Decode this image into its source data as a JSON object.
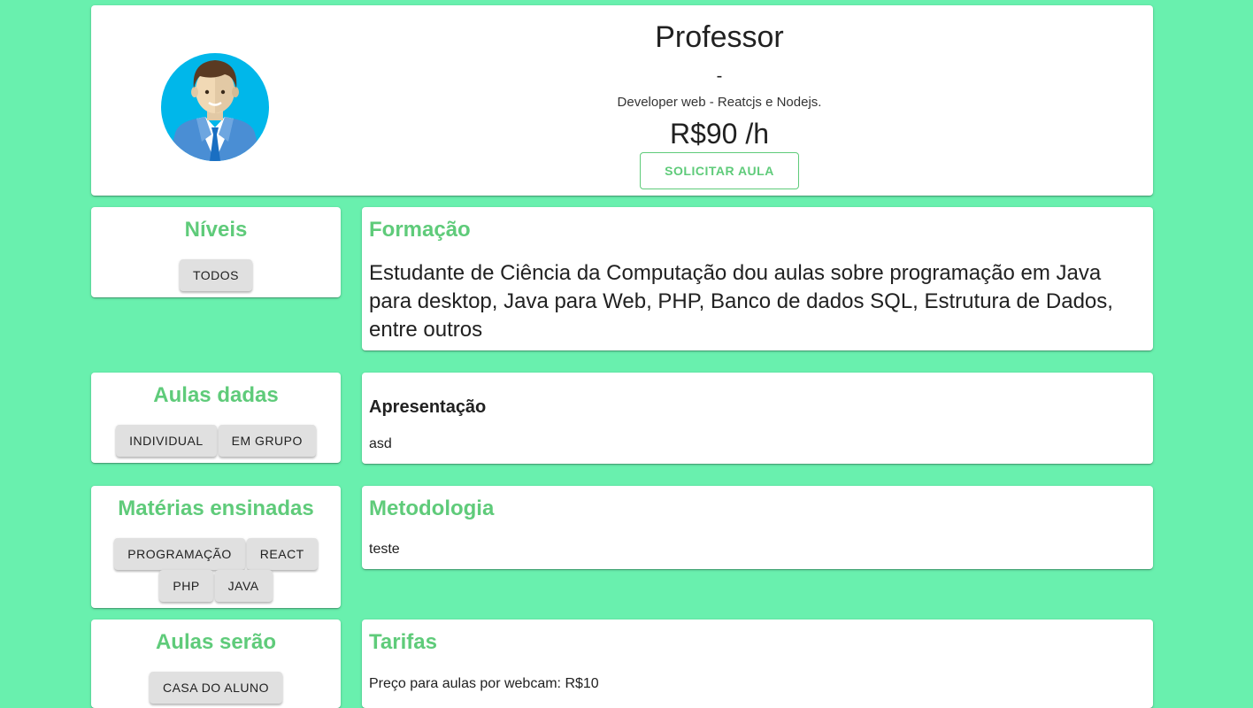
{
  "colors": {
    "background": "#69f0ae",
    "accent": "#5fcb7a",
    "chip": "#e0e0e0"
  },
  "profile": {
    "avatar_icon": "teacher-avatar-icon",
    "name": "Professor",
    "dash": "-",
    "bio": "Developer web - Reatcjs e Nodejs.",
    "rate": "R$90 /h",
    "request_button": "SOLICITAR AULA"
  },
  "levels": {
    "title": "Níveis",
    "chips": [
      "TODOS"
    ]
  },
  "classes_given": {
    "title": "Aulas dadas",
    "chips": [
      "INDIVIDUAL",
      "EM GRUPO"
    ]
  },
  "subjects": {
    "title": "Matérias ensinadas",
    "chips": [
      "PROGRAMAÇÃO",
      "REACT",
      "PHP",
      "JAVA"
    ]
  },
  "location": {
    "title": "Aulas serão",
    "chips": [
      "CASA DO ALUNO"
    ]
  },
  "education": {
    "title": "Formação",
    "text": "Estudante de Ciência da Computação dou aulas sobre programação em Java para desktop, Java para Web, PHP, Banco de dados SQL, Estrutura de Dados, entre outros"
  },
  "presentation": {
    "title": "Apresentação",
    "text": "asd"
  },
  "methodology": {
    "title": "Metodologia",
    "text": "teste"
  },
  "fees": {
    "title": "Tarifas",
    "webcam_price": "Preço para aulas por webcam: R$10"
  }
}
